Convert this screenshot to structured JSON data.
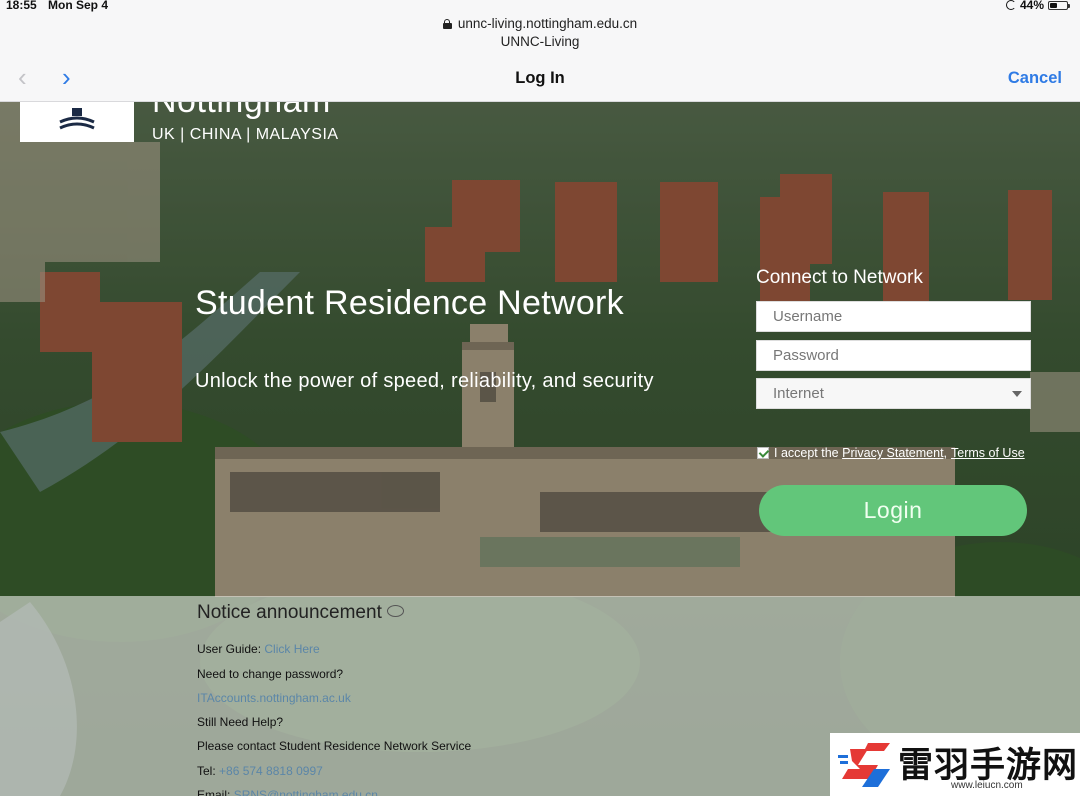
{
  "status": {
    "time": "18:55",
    "date": "Mon Sep 4",
    "battery": "44%",
    "battery_level": 0.44
  },
  "browser": {
    "url": "unnc-living.nottingham.edu.cn",
    "site_title": "UNNC-Living",
    "nav_title": "Log In",
    "cancel_label": "Cancel",
    "back_glyph": "‹",
    "forward_glyph": "›"
  },
  "brand": {
    "name": "Nottingham",
    "regions": "UK  |  CHINA  |  MALAYSIA"
  },
  "hero": {
    "title": "Student Residence Network",
    "subtitle": "Unlock the power of speed, reliability, and security"
  },
  "login_form": {
    "heading": "Connect to Network",
    "username_placeholder": "Username",
    "password_placeholder": "Password",
    "network_selected": "Internet",
    "accept_prefix": "I accept the ",
    "privacy_link": "Privacy Statement",
    "separator": ",",
    "terms_link": "Terms of Use",
    "accepted": true,
    "login_label": "Login"
  },
  "notice": {
    "title": "Notice announcement",
    "user_guide_label": "User Guide: ",
    "user_guide_link": "Click Here",
    "change_password": "Need to change password?",
    "accounts_link": "ITAccounts.nottingham.ac.uk",
    "still_help": "Still Need Help?",
    "contact": "Please contact Student Residence Network Service",
    "tel_label": "Tel: ",
    "tel_value": "+86 574 8818 0997",
    "email_label": "Email: ",
    "email_value": "SRNS@nottingham.edu.cn"
  },
  "watermark": {
    "text": "雷羽手游网",
    "url": "www.leiucn.com"
  },
  "colors": {
    "accent": "#2f7be5",
    "login": "#62c67a"
  }
}
